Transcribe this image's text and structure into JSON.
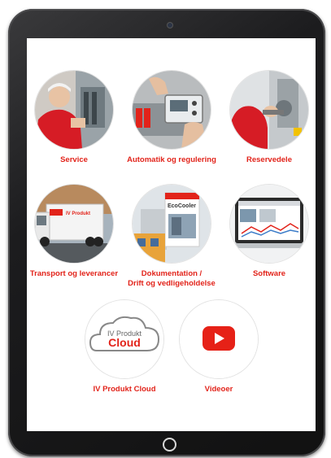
{
  "brand": {
    "accent": "#e2231a",
    "frame": "#1c1c1e"
  },
  "tiles": [
    {
      "label": "Service",
      "icon": "service-technician-photo"
    },
    {
      "label": "Automatik og regulering",
      "icon": "control-panel-photo"
    },
    {
      "label": "Reservedele",
      "icon": "spare-parts-photo"
    },
    {
      "label": "Transport og leverancer",
      "icon": "delivery-truck-photo",
      "truck_text": "IV Produkt"
    },
    {
      "label": "Dokumentation /",
      "label2": "Drift og vedligeholdelse",
      "icon": "documentation-photo",
      "brochure_title": "EcoCooler"
    },
    {
      "label": "Software",
      "icon": "software-laptop-photo"
    },
    {
      "label": "IV Produkt Cloud",
      "icon": "cloud-logo",
      "logo_line1": "IV Produkt",
      "logo_line2": "Cloud"
    },
    {
      "label": "Videoer",
      "icon": "youtube-play-icon"
    }
  ]
}
